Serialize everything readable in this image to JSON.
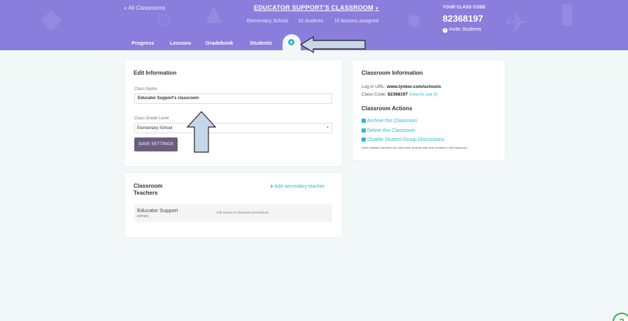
{
  "header": {
    "back_link": "« All Classrooms",
    "class_title": "EDUCATOR SUPPORT'S CLASSROOM",
    "grade": "Elementary School",
    "students": "10 students",
    "lessons": "15 lessons assigned",
    "code_label": "YOUR CLASS CODE",
    "code_value": "82368197",
    "invite": "Invite Students",
    "tabs": [
      "Progress",
      "Lessons",
      "Gradebook",
      "Students"
    ],
    "background_color": "#8a7ddc"
  },
  "edit_info": {
    "title": "Edit Information",
    "class_name_label": "Class Name",
    "class_name_value": "Educator Support's classroom",
    "grade_label": "Class Grade Level",
    "grade_value": "Elementary School",
    "save_button": "SAVE SETTINGS"
  },
  "teachers": {
    "title": "Classroom Teachers",
    "add_link": "Add secondary teacher",
    "rows": [
      {
        "name": "Educator Support",
        "role": "primary",
        "permission": "Full access to classroom permissions"
      }
    ]
  },
  "classroom_info": {
    "title": "Classroom Information",
    "login_label": "Log in URL:",
    "login_url": "www.tynker.com/schools",
    "code_label": "Class Code:",
    "code_value": "82368197",
    "code_help": "(how to use it)",
    "actions_title": "Classroom Actions",
    "actions": [
      {
        "label": "Archive this Classroom",
        "icon": "folder-icon"
      },
      {
        "label": "Delete this Classroom",
        "icon": "trash-icon"
      },
      {
        "label": "Disable Student Group Discussions",
        "icon": "trash-icon"
      }
    ],
    "discussion_note": "When enabled, students can share their projects with other students in this classroom."
  },
  "help_button": "?",
  "accent_color": "#30b7c9"
}
